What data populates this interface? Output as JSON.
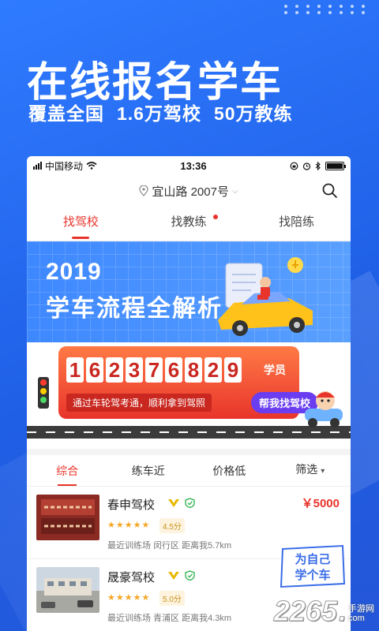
{
  "promo": {
    "title": "在线报名学车",
    "sub_1": "覆盖全国",
    "sub_2": "1.6万驾校",
    "sub_3": "50万教练"
  },
  "statusbar": {
    "carrier": "中国移动",
    "time": "13:36"
  },
  "location": {
    "address": "宜山路 2007号"
  },
  "tabs": [
    {
      "label": "找驾校",
      "active": true
    },
    {
      "label": "找教练",
      "has_dot": true
    },
    {
      "label": "找陪练"
    }
  ],
  "banner1": {
    "year": "2019",
    "title": "学车流程全解析"
  },
  "banner2": {
    "digits": [
      "1",
      "6",
      "2",
      "3",
      "7",
      "6",
      "8",
      "2",
      "9"
    ],
    "unit": "学员",
    "slogan": "通过车轮驾考通，顺利拿到驾照",
    "button": "帮我找驾校"
  },
  "filters": [
    {
      "label": "综合",
      "active": true
    },
    {
      "label": "练车近"
    },
    {
      "label": "价格低"
    },
    {
      "label": "筛选",
      "dropdown": true
    }
  ],
  "schools": [
    {
      "name": "春申驾校",
      "stars": "★★★★★",
      "score": "4.5分",
      "location": "最近训练场 闵行区 距离我5.7km",
      "price": "￥5000"
    },
    {
      "name": "晟豪驾校",
      "stars": "★★★★★",
      "score": "5.0分",
      "location": "最近训练场 青浦区 距离我4.3km",
      "price": ""
    }
  ],
  "sticker": {
    "line1": "为自己",
    "line2": "学个车"
  },
  "watermark": {
    "number": "2265",
    "dot": ".",
    "line1": "手游网",
    "line2": "com"
  },
  "colors": {
    "accent": "#e8342b",
    "brand_blue": "#2a6cf0"
  }
}
